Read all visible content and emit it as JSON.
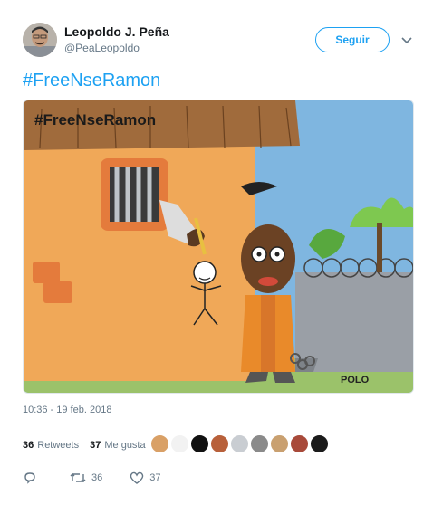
{
  "author": {
    "name": "Leopoldo J. Peña",
    "handle": "@PeaLeopoldo"
  },
  "follow_button_label": "Seguir",
  "tweet_text": "#FreeNseRamon",
  "media": {
    "caption": "#FreeNseRamon",
    "signature": "POLO"
  },
  "timestamp": "10:36 - 19 feb. 2018",
  "stats": {
    "retweets_count": "36",
    "retweets_label": "Retweets",
    "likes_count": "37",
    "likes_label": "Me gusta"
  },
  "actions": {
    "reply_icon": "reply-icon",
    "retweet_count": "36",
    "like_count": "37"
  },
  "colors": {
    "accent": "#1da1f2",
    "secondary_text": "#657786",
    "divider": "#e6ecf0"
  }
}
